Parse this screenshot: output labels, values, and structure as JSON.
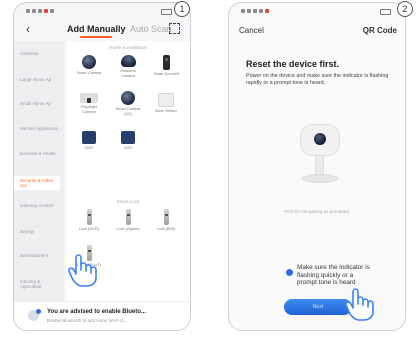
{
  "steps": [
    "1",
    "2"
  ],
  "left": {
    "tabs": {
      "manual": "Add Manually",
      "auto": "Auto Scan"
    },
    "sidebar": [
      "Cameras",
      "Large Home Ap",
      "Small Home Ap",
      "Kitchen Appliances",
      "Exercise & Health",
      "Security & Video Sur",
      "Gateway Control",
      "Energy",
      "Entertainment",
      "Industry & Agriculture"
    ],
    "sections": {
      "home_surveillance": "Home Surveillance",
      "smart_lock": "Smart Lock"
    },
    "cameras": [
      {
        "label": "Smart Camera",
        "icon": "ball-camera-icon"
      },
      {
        "label": "Outdoors Camera",
        "icon": "dome-camera-icon"
      },
      {
        "label": "Smart Doorbell",
        "icon": "doorbell-icon"
      },
      {
        "label": "Floodlight Camera",
        "icon": "floodlight-camera-icon"
      },
      {
        "label": "Smart Camera (4G)",
        "icon": "ball-camera-icon"
      },
      {
        "label": "Base Station",
        "icon": "base-station-icon"
      },
      {
        "label": "NVR",
        "icon": "nvr-icon"
      },
      {
        "label": "DVR",
        "icon": "dvr-icon"
      }
    ],
    "locks": [
      {
        "label": "Lock (Wi-Fi)"
      },
      {
        "label": "Lock (Zigbee)"
      },
      {
        "label": "Lock (BLE)"
      },
      {
        "label": "Lock (NB-IoT)"
      }
    ],
    "bluetooth": {
      "title": "You are advised to enable Blueto...",
      "subtitle": "Enable Bluetooth to add some Wi-Fi d..."
    }
  },
  "right": {
    "cancel": "Cancel",
    "qr": "QR Code",
    "title": "Reset the device first.",
    "body": "Power on the device and make sure the indicator is flashing rapidly or a prompt tone is heard.",
    "caption": "Perform net-pairing as prompted.",
    "confirm": "Make sure the indicator is flashing quickly or a prompt tone is heard",
    "next": "Next"
  }
}
